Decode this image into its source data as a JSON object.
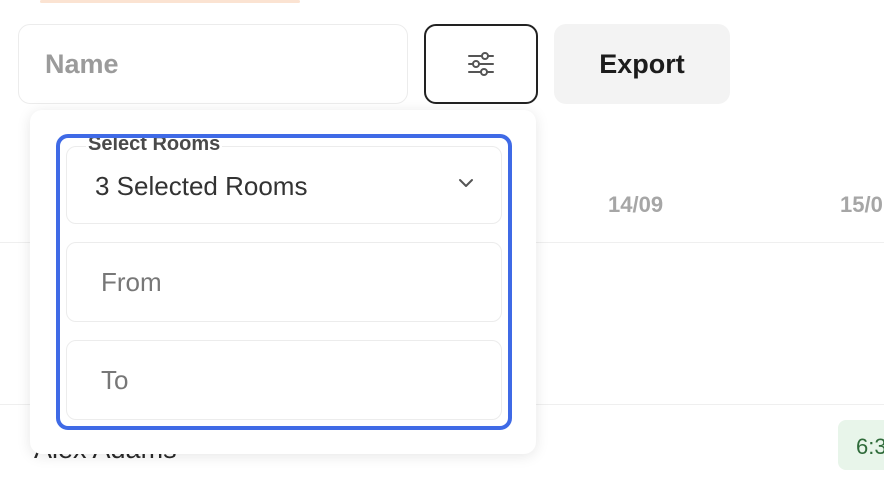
{
  "toolbar": {
    "name_placeholder": "Name",
    "filter_icon": "sliders-icon",
    "export_label": "Export"
  },
  "table": {
    "date_columns": [
      "14/09",
      "15/0"
    ],
    "rows": [
      {
        "name": "Alex Adams",
        "time": "6:3"
      }
    ]
  },
  "filter_panel": {
    "rooms_label": "Select Rooms",
    "rooms_value": "3 Selected Rooms",
    "from_placeholder": "From",
    "to_placeholder": "To"
  },
  "colors": {
    "highlight": "#3f6ae6",
    "time_chip_bg": "#e8f5ea",
    "time_chip_text": "#2f6b3a"
  }
}
